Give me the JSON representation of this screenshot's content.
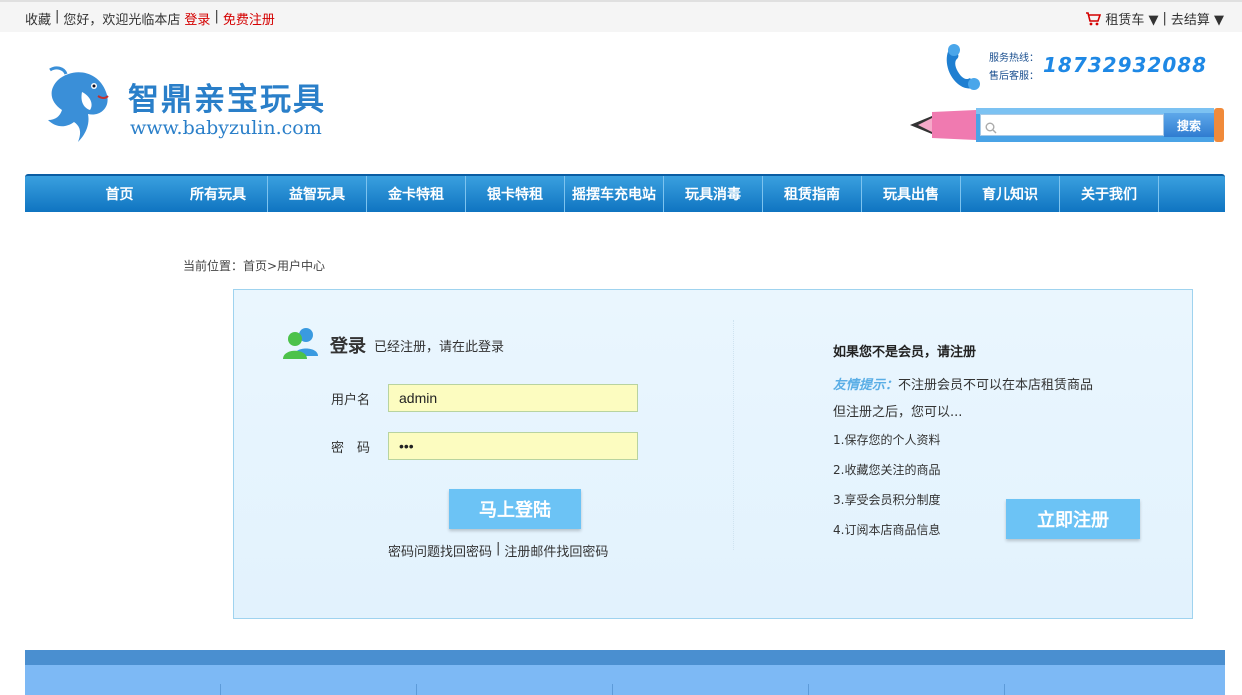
{
  "topbar": {
    "favorite": "收藏",
    "greeting": "您好，欢迎光临本店",
    "login": "登录",
    "register": "免费注册",
    "cart": "租赁车 ▼",
    "checkout": "去结算 ▼"
  },
  "header": {
    "brand_title": "智鼎亲宝玩具",
    "brand_url": "www.babyzulin.com",
    "hotline_label": "服务热线：",
    "aftersale_label": "售后客服：",
    "hotline_number": "18732932088",
    "search_placeholder": "",
    "search_button": "搜索"
  },
  "nav": {
    "items": [
      "首页",
      "所有玩具",
      "益智玩具",
      "金卡特租",
      "银卡特租",
      "摇摆车充电站",
      "玩具消毒",
      "租赁指南",
      "玩具出售",
      "育儿知识",
      "关于我们"
    ]
  },
  "breadcrumb": "当前位置：首页>用户中心",
  "login": {
    "title": "登录",
    "subtitle": "已经注册，请在此登录",
    "username_label": "用户名",
    "username_value": "admin",
    "password_label": "密　码",
    "password_value": "•••",
    "submit": "马上登陆",
    "recover_question": "密码问题找回密码",
    "recover_sep": "|",
    "recover_email": "注册邮件找回密码"
  },
  "register": {
    "title": "如果您不是会员，请注册",
    "tip_label": "友情提示：",
    "tip_text": "不注册会员不可以在本店租赁商品",
    "tip_text2": "但注册之后，您可以...",
    "benefits": [
      "1.保存您的个人资料",
      "2.收藏您关注的商品",
      "3.享受会员积分制度",
      "4.订阅本店商品信息"
    ],
    "button": "立即注册"
  },
  "colors": {
    "accent": "#2a7fc9",
    "nav": "#1a85cf",
    "button": "#6cc3f5",
    "link_red": "#d40000"
  }
}
